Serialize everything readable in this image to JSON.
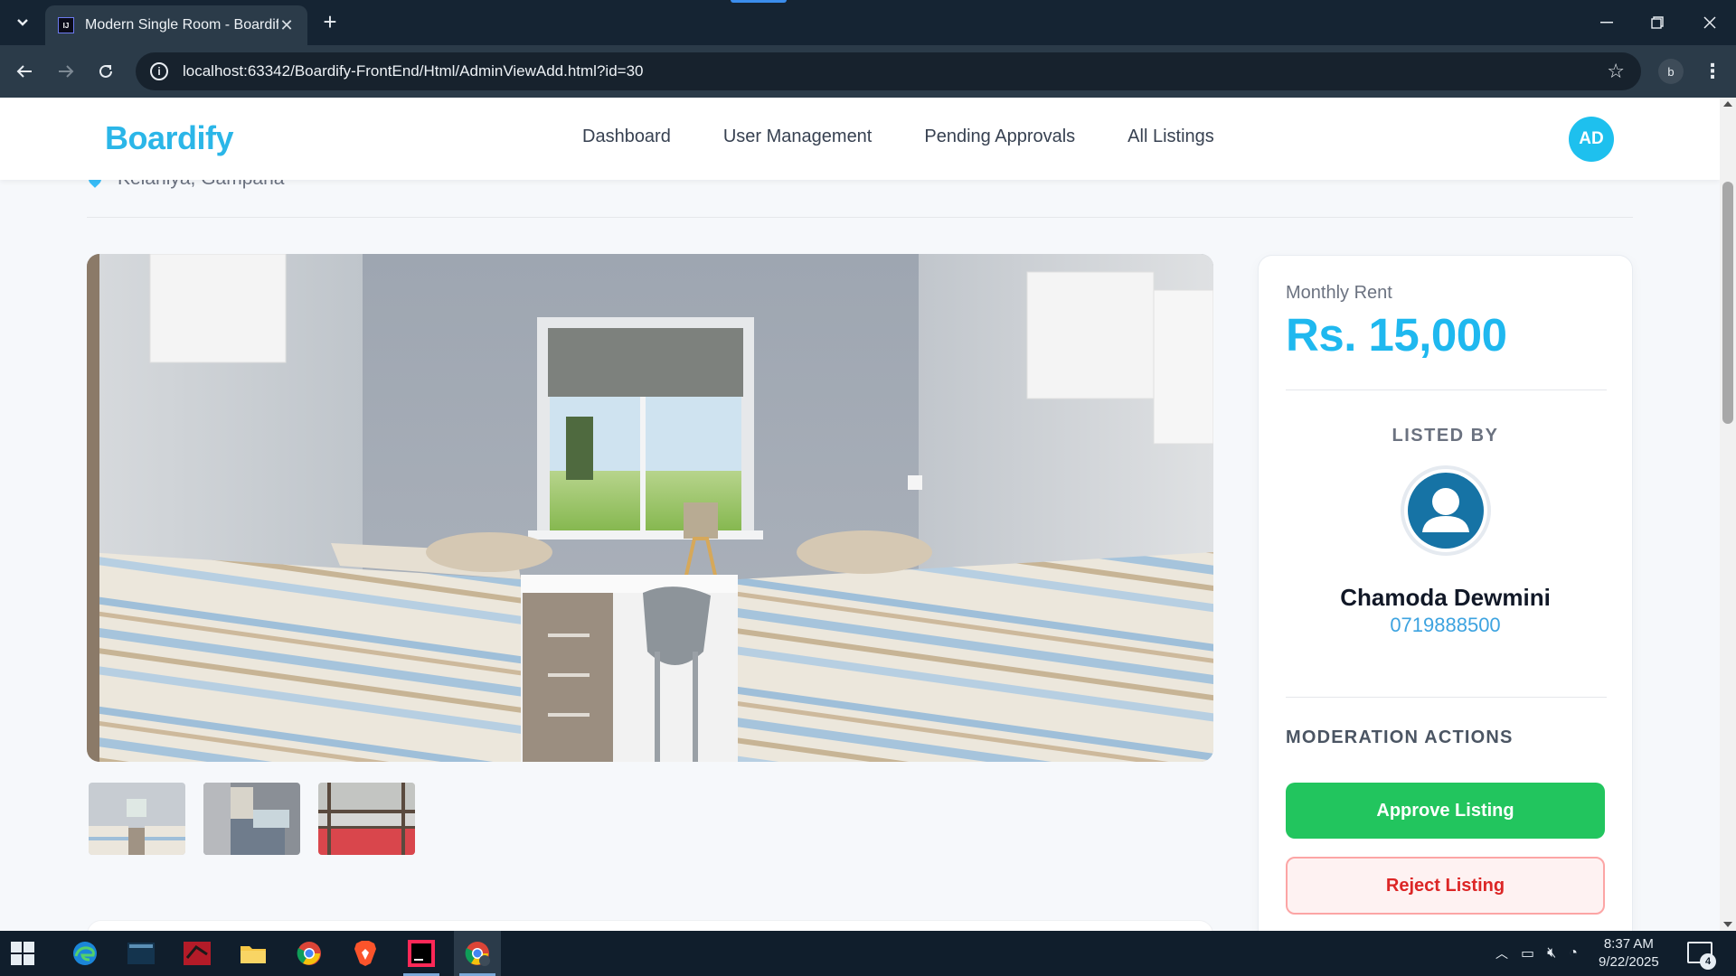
{
  "browser": {
    "tab_title": "Modern Single Room - Boardify",
    "url": "localhost:63342/Boardify-FrontEnd/Html/AdminViewAdd.html?id=30",
    "profile_initial": "b"
  },
  "navbar": {
    "brand": "Boardify",
    "links": [
      "Dashboard",
      "User Management",
      "Pending Approvals",
      "All Listings"
    ],
    "avatar_initials": "AD"
  },
  "listing": {
    "location": "Kelaniya, Gampaha"
  },
  "sidebar": {
    "rent_label": "Monthly Rent",
    "rent_value": "Rs. 15,000",
    "listed_by_label": "LISTED BY",
    "owner_name": "Chamoda Dewmini",
    "owner_phone": "0719888500",
    "moderation_title": "MODERATION ACTIONS",
    "approve_label": "Approve Listing",
    "reject_label": "Reject Listing"
  },
  "taskbar": {
    "time": "8:37 AM",
    "date": "9/22/2025",
    "notification_count": "4"
  },
  "colors": {
    "brand": "#2bb6e8",
    "approve": "#22c55e",
    "reject": "#dc2626"
  }
}
